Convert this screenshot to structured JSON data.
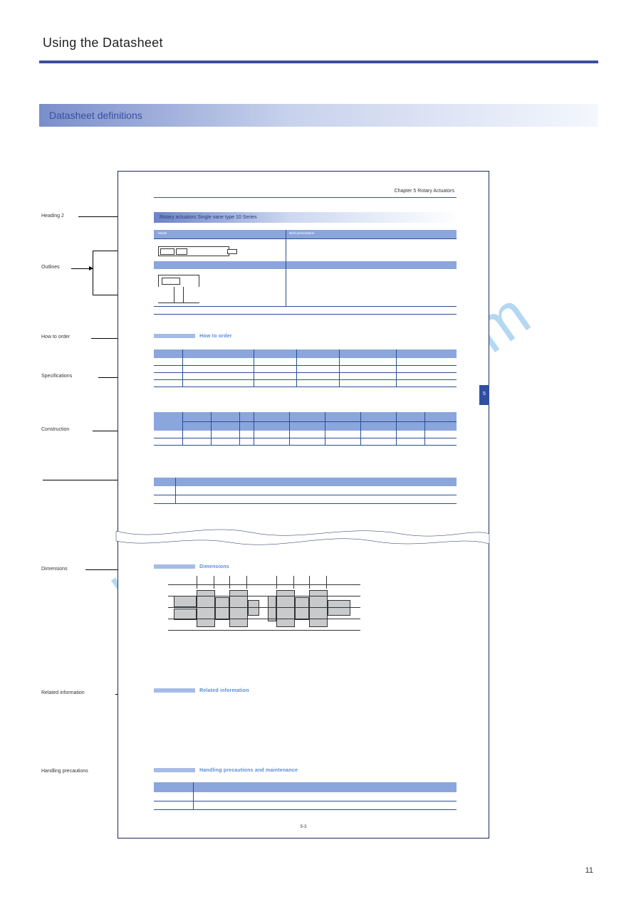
{
  "pageTitle": "Using the Datasheet",
  "gradBarTitle": "Datasheet definitions",
  "introText": "",
  "labels": {
    "heading": "Heading 2",
    "outlines": "Outlines",
    "howToOrder": "How to order",
    "specs": "Specifications",
    "construction": "Construction",
    "dimensions": "Dimensions",
    "relatedInfo": "Related information",
    "handling": "Handling precautions"
  },
  "sample": {
    "headingText": "Chapter 5  Rotary Actuators",
    "gradTitle": "Rotary actuators  Single vane type  10 Series",
    "table1": {
      "h1": "Model",
      "h2": "Brief presentation"
    },
    "howToOrder": "How to order",
    "specsRows": 4,
    "constructionRows": 2,
    "dimsTitle": "Dimensions",
    "relatedTitle": "Related information",
    "handlingTitle": "Handling precautions and maintenance",
    "tabNumber": "5",
    "bottomPg": "5-3"
  },
  "mainPageNumber": "11",
  "watermark": "manualshive.com"
}
